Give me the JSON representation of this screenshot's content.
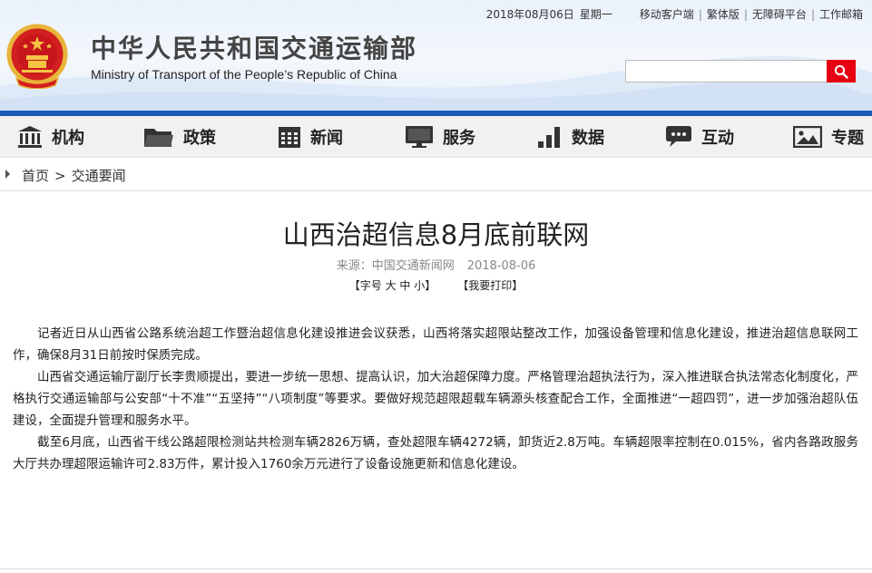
{
  "topbar": {
    "date": "2018年08月06日",
    "weekday": "星期一",
    "links": [
      "移动客户端",
      "繁体版",
      "无障碍平台",
      "工作邮箱"
    ]
  },
  "header": {
    "title_cn": "中华人民共和国交通运输部",
    "title_en": "Ministry of Transport of the People’s Republic of China",
    "search_placeholder": "",
    "accent_color": "#e60012",
    "band_color": "#1b5eb8"
  },
  "nav": {
    "items": [
      {
        "label": "机构",
        "icon": "building-icon"
      },
      {
        "label": "政策",
        "icon": "folder-icon"
      },
      {
        "label": "新闻",
        "icon": "calendar-icon"
      },
      {
        "label": "服务",
        "icon": "monitor-icon"
      },
      {
        "label": "数据",
        "icon": "bar-chart-icon"
      },
      {
        "label": "互动",
        "icon": "chat-bubble-icon"
      },
      {
        "label": "专题",
        "icon": "image-icon"
      }
    ]
  },
  "breadcrumb": {
    "home": "首页",
    "separator": ">",
    "current": "交通要闻"
  },
  "article": {
    "title": "山西治超信息8月底前联网",
    "source": "来源：中国交通新闻网",
    "date": "2018-08-06",
    "font_size_tool": "【字号 大 中 小】",
    "print_tool": "【我要打印】",
    "paragraphs": [
      "记者近日从山西省公路系统治超工作暨治超信息化建设推进会议获悉，山西将落实超限站整改工作，加强设备管理和信息化建设，推进治超信息联网工作，确保8月31日前按时保质完成。",
      "山西省交通运输厅副厅长李贵顺提出，要进一步统一思想、提高认识，加大治超保障力度。严格管理治超执法行为，深入推进联合执法常态化制度化，严格执行交通运输部与公安部“十不准”“五坚持”“八项制度”等要求。要做好规范超限超载车辆源头核查配合工作，全面推进“一超四罚”，进一步加强治超队伍建设，全面提升管理和服务水平。",
      "截至6月底，山西省干线公路超限检测站共检测车辆2826万辆，查处超限车辆4272辆，卸货近2.8万吨。车辆超限率控制在0.015%，省内各路政服务大厅共办理超限运输许可2.83万件，累计投入1760余万元进行了设备设施更新和信息化建设。"
    ]
  }
}
